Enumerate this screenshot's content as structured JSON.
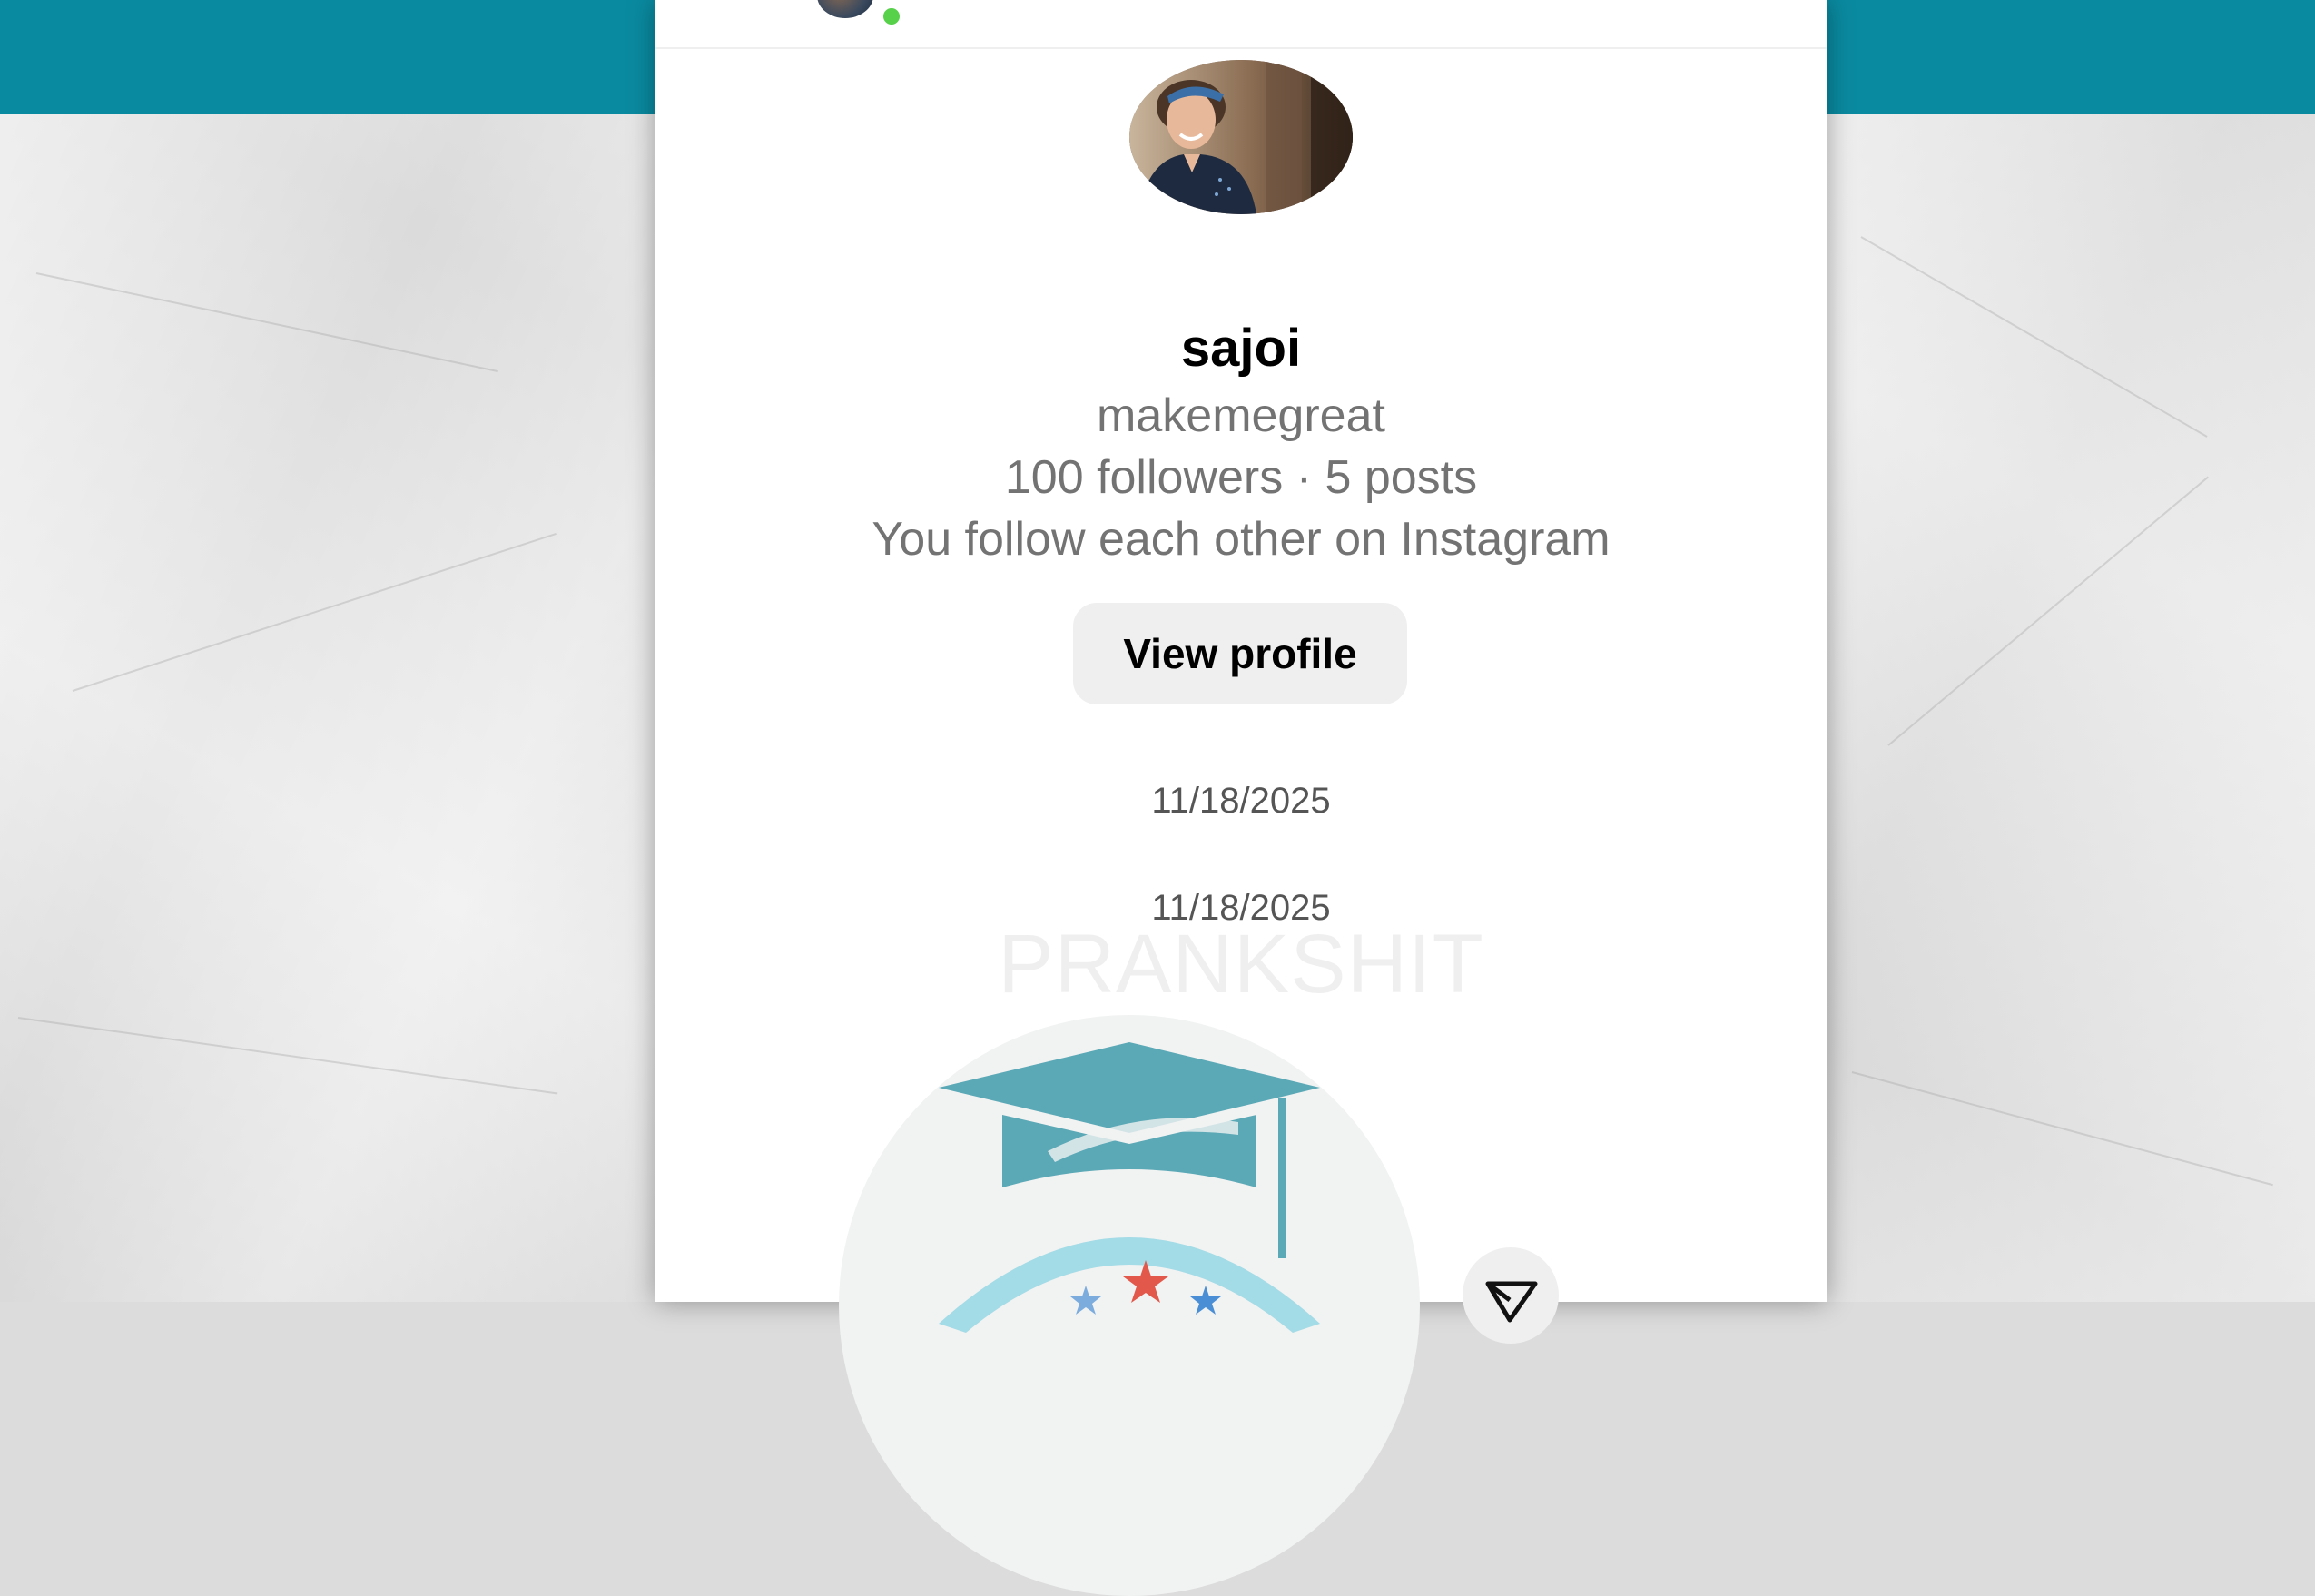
{
  "profile": {
    "display_name": "sajoi",
    "username": "makemegreat",
    "stats": "100 followers · 5 posts",
    "mutual_note": "You follow each other on Instagram",
    "view_profile_label": "View profile"
  },
  "thread": {
    "dates": [
      "11/18/2025",
      "11/18/2025"
    ]
  },
  "overlay": {
    "watermark": "PRANKSHIT"
  },
  "colors": {
    "header_band": "#0a8aa0",
    "online_indicator": "#57d14a",
    "secondary_text": "#737373",
    "button_bg": "#efefef",
    "logo_cap": "#5ba8b6",
    "logo_arc": "#a3dbe6",
    "logo_star_red": "#e2584a",
    "logo_star_blue": "#4a8fd6"
  },
  "icons": {
    "online_dot": "online-status-icon",
    "share": "send-icon",
    "logo": "graduation-cap-logo"
  }
}
